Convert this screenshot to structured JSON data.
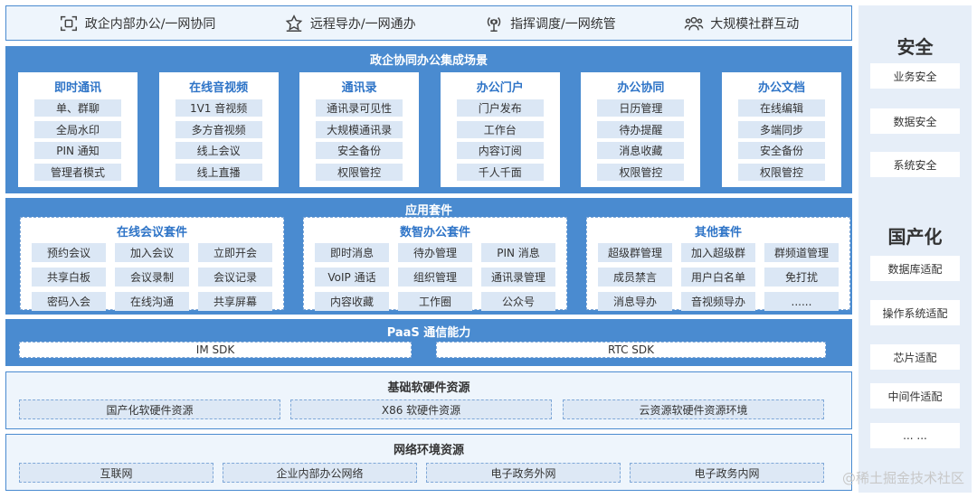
{
  "top_bar": {
    "items": [
      {
        "icon": "collaboration-icon",
        "label": "政企内部办公/一网协同"
      },
      {
        "icon": "remote-guide-icon",
        "label": "远程导办/一网通办"
      },
      {
        "icon": "dispatch-icon",
        "label": "指挥调度/一网统管"
      },
      {
        "icon": "community-icon",
        "label": "大规模社群互动"
      }
    ]
  },
  "integrated_scenes": {
    "title": "政企协同办公集成场景",
    "cards": [
      {
        "title": "即时通讯",
        "items": [
          "单、群聊",
          "全局水印",
          "PIN 通知",
          "管理者模式"
        ]
      },
      {
        "title": "在线音视频",
        "items": [
          "1V1 音视频",
          "多方音视频",
          "线上会议",
          "线上直播"
        ]
      },
      {
        "title": "通讯录",
        "items": [
          "通讯录可见性",
          "大规模通讯录",
          "安全备份",
          "权限管控"
        ]
      },
      {
        "title": "办公门户",
        "items": [
          "门户发布",
          "工作台",
          "内容订阅",
          "千人千面"
        ]
      },
      {
        "title": "办公协同",
        "items": [
          "日历管理",
          "待办提醒",
          "消息收藏",
          "权限管控"
        ]
      },
      {
        "title": "办公文档",
        "items": [
          "在线编辑",
          "多端同步",
          "安全备份",
          "权限管控"
        ]
      }
    ]
  },
  "app_suites": {
    "title": "应用套件",
    "groups": [
      {
        "title": "在线会议套件",
        "items": [
          "预约会议",
          "加入会议",
          "立即开会",
          "共享白板",
          "会议录制",
          "会议记录",
          "密码入会",
          "在线沟通",
          "共享屏幕"
        ]
      },
      {
        "title": "数智办公套件",
        "items": [
          "即时消息",
          "待办管理",
          "PIN 消息",
          "VoIP 通话",
          "组织管理",
          "通讯录管理",
          "内容收藏",
          "工作圈",
          "公众号"
        ]
      },
      {
        "title": "其他套件",
        "items": [
          "超级群管理",
          "加入超级群",
          "群频道管理",
          "成员禁言",
          "用户白名单",
          "免打扰",
          "消息导办",
          "音视频导办",
          "......"
        ]
      }
    ]
  },
  "paas": {
    "title": "PaaS 通信能力",
    "items": [
      "IM SDK",
      "RTC SDK"
    ]
  },
  "infra": {
    "title": "基础软硬件资源",
    "items": [
      "国产化软硬件资源",
      "X86 软硬件资源",
      "云资源软硬件资源环境"
    ]
  },
  "network": {
    "title": "网络环境资源",
    "items": [
      "互联网",
      "企业内部办公网络",
      "电子政务外网",
      "电子政务内网"
    ]
  },
  "right_column": {
    "security_title": "安全",
    "security_items": [
      "业务安全",
      "数据安全",
      "系统安全"
    ],
    "localization_title": "国产化",
    "localization_items": [
      "数据库适配",
      "操作系统适配",
      "芯片适配",
      "中间件适配",
      "... ..."
    ]
  },
  "watermark": "@稀土掘金技术社区",
  "colors": {
    "primary_blue": "#4a8bd0",
    "title_blue": "#2e74c7",
    "pill_bg": "#dbe7f5",
    "light_bg": "#eef5fc"
  }
}
